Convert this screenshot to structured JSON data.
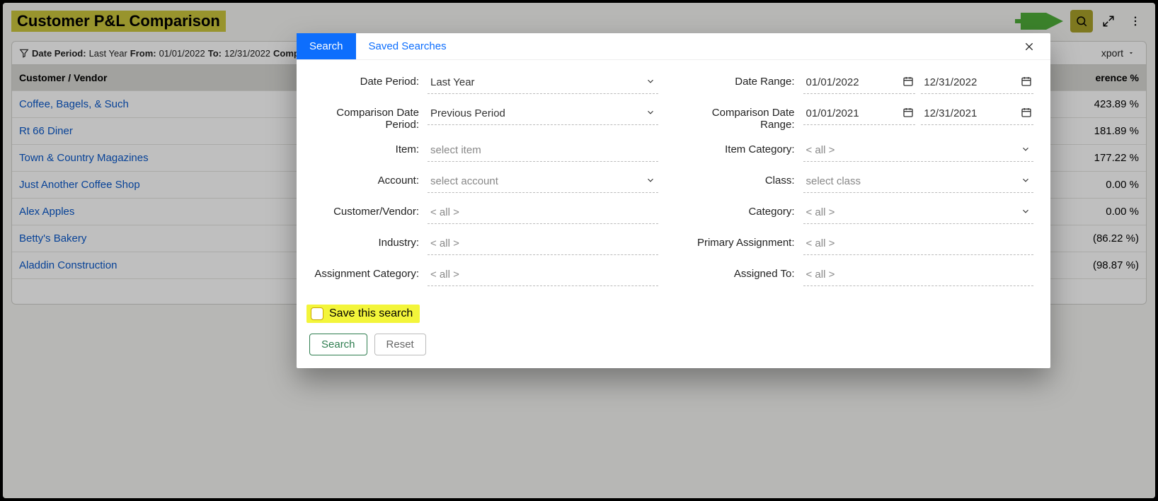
{
  "header": {
    "title": "Customer P&L Comparison"
  },
  "filter_bar": {
    "date_period_label": "Date Period:",
    "date_period_value": "Last Year",
    "from_label": "From:",
    "from_value": "01/01/2022",
    "to_label": "To:",
    "to_value": "12/31/2022",
    "comparison_label": "Comparison D",
    "export_label": "xport"
  },
  "table": {
    "col_name": "Customer / Vendor",
    "col_diff": "erence %",
    "rows": [
      {
        "name": "Coffee, Bagels, & Such",
        "diff": "423.89 %"
      },
      {
        "name": "Rt 66 Diner",
        "diff": "181.89 %"
      },
      {
        "name": "Town & Country Magazines",
        "diff": "177.22 %"
      },
      {
        "name": "Just Another Coffee Shop",
        "diff": "0.00 %"
      },
      {
        "name": "Alex Apples",
        "diff": "0.00 %"
      },
      {
        "name": "Betty's Bakery",
        "diff": "(86.22 %)"
      },
      {
        "name": "Aladdin Construction",
        "diff": "(98.87 %)"
      }
    ]
  },
  "modal": {
    "tabs": {
      "search": "Search",
      "saved": "Saved Searches"
    },
    "labels": {
      "date_period": "Date Period:",
      "date_range": "Date Range:",
      "comp_date_period": "Comparison Date Period:",
      "comp_date_range": "Comparison Date Range:",
      "item": "Item:",
      "item_category": "Item Category:",
      "account": "Account:",
      "class": "Class:",
      "customer_vendor": "Customer/Vendor:",
      "category": "Category:",
      "industry": "Industry:",
      "primary_assignment": "Primary Assignment:",
      "assignment_category": "Assignment Category:",
      "assigned_to": "Assigned To:"
    },
    "values": {
      "date_period": "Last Year",
      "comp_date_period": "Previous Period",
      "date_range_from": "01/01/2022",
      "date_range_to": "12/31/2022",
      "comp_date_range_from": "01/01/2021",
      "comp_date_range_to": "12/31/2021",
      "all": "< all >"
    },
    "placeholders": {
      "item": "select item",
      "account": "select account",
      "class": "select class"
    },
    "save_label": "Save this search",
    "search_btn": "Search",
    "reset_btn": "Reset"
  }
}
